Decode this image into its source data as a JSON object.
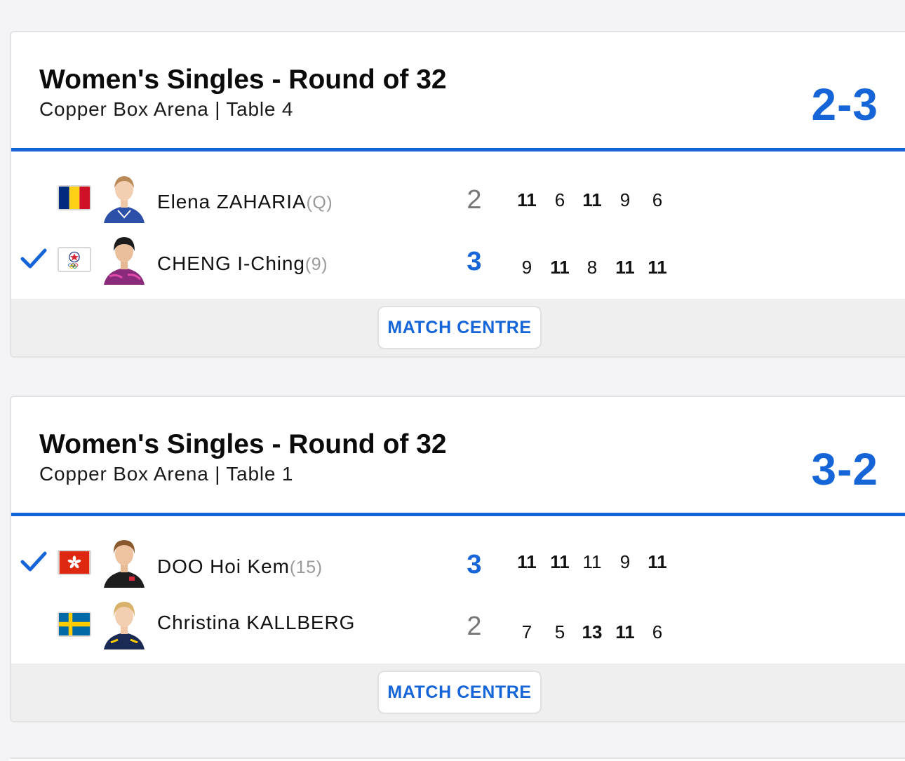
{
  "matches": [
    {
      "title": "Women's Singles - Round of 32",
      "venue": "Copper Box Arena | Table 4",
      "score": "2-3",
      "button_label": "MATCH CENTRE",
      "players": [
        {
          "name": "Elena ZAHARIA",
          "seed": "(Q)",
          "country_flag": "romania-flag",
          "games": "2",
          "winner": false,
          "sets": [
            "11",
            "6",
            "11",
            "9",
            "6"
          ],
          "sets_bold": [
            true,
            false,
            true,
            false,
            false
          ]
        },
        {
          "name": "CHENG I-Ching",
          "seed": "(9)",
          "country_flag": "chinese-taipei-flag",
          "games": "3",
          "winner": true,
          "sets": [
            "9",
            "11",
            "8",
            "11",
            "11"
          ],
          "sets_bold": [
            false,
            true,
            false,
            true,
            true
          ]
        }
      ]
    },
    {
      "title": "Women's Singles - Round of 32",
      "venue": "Copper Box Arena | Table 1",
      "score": "3-2",
      "button_label": "MATCH CENTRE",
      "players": [
        {
          "name": "DOO Hoi Kem",
          "seed": "(15)",
          "country_flag": "hong-kong-flag",
          "games": "3",
          "winner": true,
          "sets": [
            "11",
            "11",
            "11",
            "9",
            "11"
          ],
          "sets_bold": [
            true,
            true,
            false,
            false,
            true
          ]
        },
        {
          "name": "Christina KALLBERG",
          "seed": "",
          "country_flag": "sweden-flag",
          "games": "2",
          "winner": false,
          "sets": [
            "7",
            "5",
            "13",
            "11",
            "6"
          ],
          "sets_bold": [
            false,
            false,
            true,
            true,
            false
          ]
        }
      ]
    }
  ],
  "colors": {
    "accent": "#1565d8",
    "page_bg": "#f4f4f6",
    "footer_bg": "#efeff0"
  }
}
